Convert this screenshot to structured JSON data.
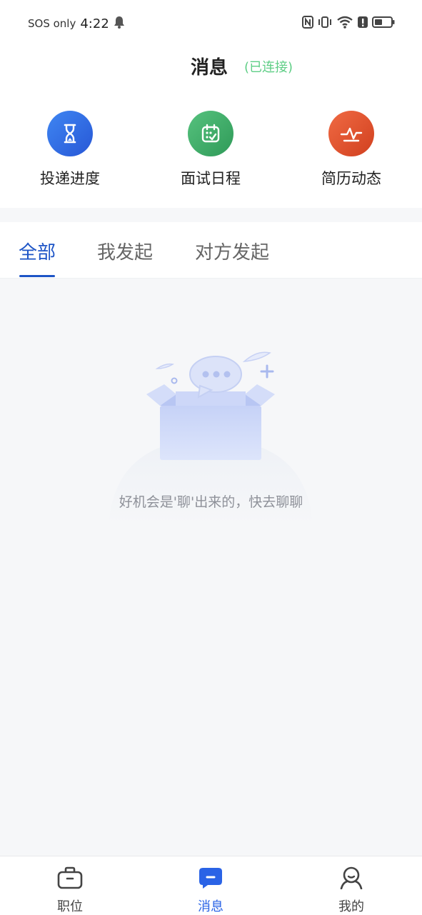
{
  "status_bar": {
    "carrier": "SOS only",
    "time": "4:22"
  },
  "header": {
    "title": "消息",
    "connection_status": "(已连接)",
    "connection_color": "#5fce86"
  },
  "quick_actions": [
    {
      "label": "投递进度",
      "icon": "hourglass-icon",
      "color": "#2f6ef0"
    },
    {
      "label": "面试日程",
      "icon": "calendar-check-icon",
      "color": "#3fae6a"
    },
    {
      "label": "简历动态",
      "icon": "pulse-icon",
      "color": "#e2542f"
    }
  ],
  "tabs": [
    {
      "label": "全部",
      "active": true
    },
    {
      "label": "我发起",
      "active": false
    },
    {
      "label": "对方发起",
      "active": false
    }
  ],
  "empty_state": {
    "message": "好机会是'聊'出来的，快去聊聊",
    "illustration": "open-box-chat-bubble"
  },
  "bottom_nav": [
    {
      "label": "职位",
      "icon": "briefcase-icon",
      "active": false
    },
    {
      "label": "消息",
      "icon": "chat-bubble-icon",
      "active": true
    },
    {
      "label": "我的",
      "icon": "profile-icon",
      "active": false
    }
  ],
  "colors": {
    "accent": "#1d54c6",
    "nav_active": "#2a63e6",
    "background": "#f6f7f9"
  }
}
